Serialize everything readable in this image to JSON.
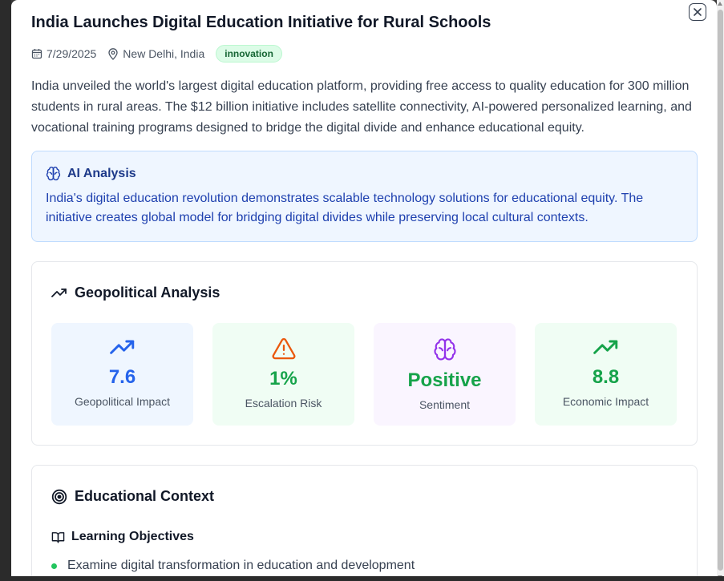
{
  "article": {
    "title": "India Launches Digital Education Initiative for Rural Schools",
    "date": "7/29/2025",
    "location": "New Delhi, India",
    "category": "innovation",
    "summary": "India unveiled the world's largest digital education platform, providing free access to quality education for 300 million students in rural areas. The $12 billion initiative includes satellite connectivity, AI-powered personalized learning, and vocational training programs designed to bridge the digital divide and enhance educational equity."
  },
  "ai_analysis": {
    "heading": "AI Analysis",
    "text": "India's digital education revolution demonstrates scalable technology solutions for educational equity. The initiative creates global model for bridging digital divides while preserving local cultural contexts."
  },
  "geopolitical": {
    "heading": "Geopolitical Analysis",
    "metrics": [
      {
        "value": "7.6",
        "label": "Geopolitical Impact",
        "icon": "trending-up-icon",
        "color": "#2563eb",
        "bg": "#eff6ff"
      },
      {
        "value": "1%",
        "label": "Escalation Risk",
        "icon": "warning-triangle-icon",
        "color": "#16a34a",
        "bg": "#f0fdf4"
      },
      {
        "value": "Positive",
        "label": "Sentiment",
        "icon": "brain-icon",
        "color": "#16a34a",
        "bg": "#faf5ff"
      },
      {
        "value": "8.8",
        "label": "Economic Impact",
        "icon": "trending-up-icon",
        "color": "#16a34a",
        "bg": "#f0fdf4"
      }
    ]
  },
  "education": {
    "heading": "Educational Context",
    "objectives_heading": "Learning Objectives",
    "objectives": [
      "Examine digital transformation in education and development"
    ]
  },
  "colors": {
    "accent_blue": "#2563eb",
    "accent_green": "#16a34a",
    "warning_orange": "#ea580c",
    "sentiment_purple": "#9333ea"
  }
}
